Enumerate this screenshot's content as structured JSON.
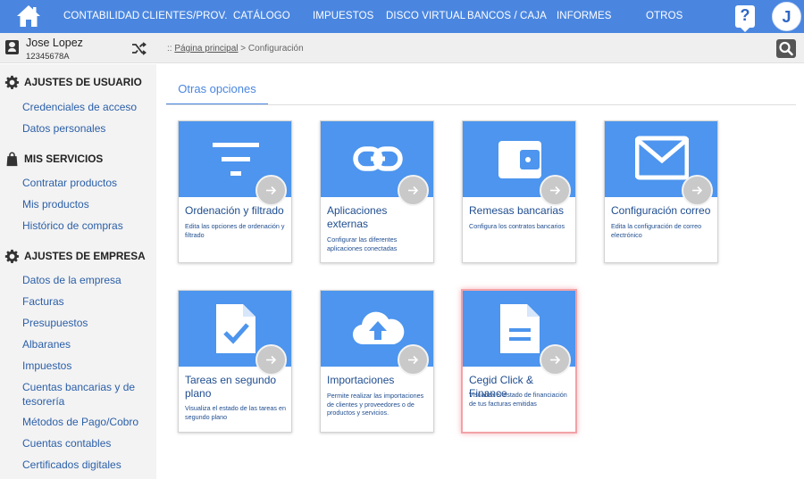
{
  "nav": {
    "items": [
      "CONTABILIDAD",
      "CLIENTES/PROV.",
      "CATÁLOGO",
      "IMPUESTOS",
      "DISCO VIRTUAL",
      "BANCOS / CAJA",
      "INFORMES",
      "OTROS"
    ],
    "help_label": "?",
    "avatar_letter": "J",
    "accent": "#4a86e0"
  },
  "user": {
    "name": "Jose Lopez",
    "id": "12345678A"
  },
  "breadcrumb": {
    "prefix": "::",
    "home": "Página principal",
    "sep": ">",
    "current": "Configuración"
  },
  "sidebar": {
    "sections": [
      {
        "title": "AJUSTES DE USUARIO",
        "icon": "gear-icon",
        "items": [
          "Credenciales de acceso",
          "Datos personales"
        ]
      },
      {
        "title": "MIS SERVICIOS",
        "icon": "bag-icon",
        "items": [
          "Contratar productos",
          "Mis productos",
          "Histórico de compras"
        ]
      },
      {
        "title": "AJUSTES DE EMPRESA",
        "icon": "gear-icon",
        "items": [
          "Datos de la empresa",
          "Facturas",
          "Presupuestos",
          "Albaranes",
          "Impuestos",
          "Cuentas bancarias y de tesorería",
          "Métodos de Pago/Cobro",
          "Cuentas contables",
          "Certificados digitales"
        ]
      }
    ]
  },
  "tab": {
    "label": "Otras opciones"
  },
  "cards": [
    {
      "title": "Ordenación y filtrado",
      "desc": "Edita las opciones de ordenación y filtrado",
      "icon": "filter-icon"
    },
    {
      "title": "Aplicaciones externas",
      "desc": "Configurar las diferentes aplicaciones conectadas",
      "icon": "link-icon"
    },
    {
      "title": "Remesas bancarias",
      "desc": "Configura los contratos bancarios",
      "icon": "wallet-icon"
    },
    {
      "title": "Configuración correo",
      "desc": "Edita la configuración de correo electrónico",
      "icon": "mail-icon"
    },
    {
      "title": "Tareas en segundo plano",
      "desc": "Visualiza el estado de las tareas en segundo plano",
      "icon": "document-check-icon"
    },
    {
      "title": "Importaciones",
      "desc": "Permite realizar las importaciones de clientes y proveedores o de productos y servicios.",
      "icon": "cloud-upload-icon"
    },
    {
      "title": "Cegid Click & Finance",
      "desc": "Visualiza el estado de financiación de tus facturas emitidas",
      "icon": "document-icon",
      "selected": true
    }
  ]
}
